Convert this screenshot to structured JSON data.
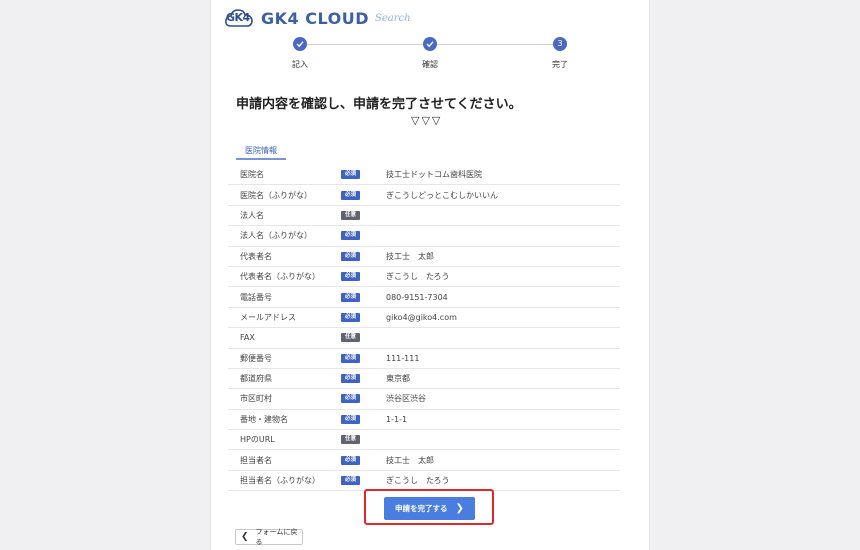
{
  "logo": {
    "mark": "GK4",
    "title": "GK4 CLOUD",
    "subtitle": "Search"
  },
  "stepper": {
    "steps": [
      {
        "label": "記入",
        "status": "done",
        "number": "1"
      },
      {
        "label": "確認",
        "status": "done",
        "number": "2"
      },
      {
        "label": "完了",
        "status": "current",
        "number": "3"
      }
    ]
  },
  "heading": "申請内容を確認し、申請を完了させてください。",
  "arrows": "▽▽▽",
  "section_tab": "医院情報",
  "badges": {
    "required": "必須",
    "optional": "任意"
  },
  "fields": [
    {
      "label": "医院名",
      "required": true,
      "value": "技工士ドットコム歯科医院"
    },
    {
      "label": "医院名（ふりがな）",
      "required": true,
      "value": "ぎこうしどっとこむしかいいん"
    },
    {
      "label": "法人名",
      "required": false,
      "value": ""
    },
    {
      "label": "法人名（ふりがな）",
      "required": true,
      "value": ""
    },
    {
      "label": "代表者名",
      "required": true,
      "value": "技工士　太郎"
    },
    {
      "label": "代表者名（ふりがな）",
      "required": true,
      "value": "ぎこうし　たろう"
    },
    {
      "label": "電話番号",
      "required": true,
      "value": "080-9151-7304"
    },
    {
      "label": "メールアドレス",
      "required": true,
      "value": "giko4@giko4.com"
    },
    {
      "label": "FAX",
      "required": false,
      "value": ""
    },
    {
      "label": "郵便番号",
      "required": true,
      "value": "111-111"
    },
    {
      "label": "都道府県",
      "required": true,
      "value": "東京都"
    },
    {
      "label": "市区町村",
      "required": true,
      "value": "渋谷区渋谷"
    },
    {
      "label": "番地・建物名",
      "required": true,
      "value": "1-1-1"
    },
    {
      "label": "HPのURL",
      "required": false,
      "value": ""
    },
    {
      "label": "担当者名",
      "required": true,
      "value": "技工士　太郎"
    },
    {
      "label": "担当者名（ふりがな）",
      "required": true,
      "value": "ぎこうし　たろう"
    }
  ],
  "submit_label": "申請を完了する",
  "back_label": "フォームに戻る",
  "colors": {
    "accent": "#4a69c6",
    "button": "#4a7de0",
    "highlight": "#e4262d",
    "optional_badge": "#5f6470"
  }
}
